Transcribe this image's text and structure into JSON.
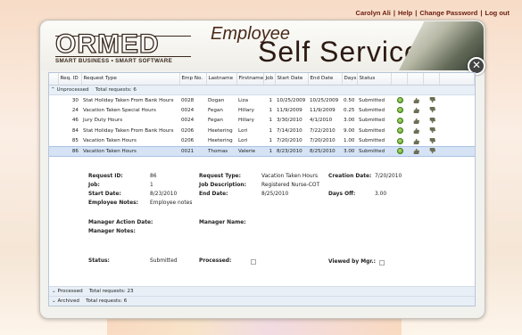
{
  "topnav": {
    "user": "Carolyn Ali",
    "help": "Help",
    "change_password": "Change Password",
    "logout": "Log out"
  },
  "header": {
    "logo": "ORMED",
    "tagline": "SMART BUSINESS • SMART SOFTWARE",
    "title_top": "Employee",
    "title_bottom": "Self Service"
  },
  "grid": {
    "columns": [
      "Req. ID",
      "Request Type",
      "Emp No.",
      "Lastname",
      "Firstname",
      "Job",
      "Start Date",
      "End Date",
      "Days",
      "Status"
    ],
    "unprocessed_label": "Unprocessed",
    "unprocessed_total": "Total requests: 6",
    "rows": [
      {
        "id": "30",
        "type": "Stat Holiday Taken From Bank Hours",
        "emp": "0028",
        "last": "Dogan",
        "first": "Liza",
        "job": "1",
        "start": "10/25/2009",
        "end": "10/25/2009",
        "days": "0.50",
        "status": "Submitted"
      },
      {
        "id": "24",
        "type": "Vacation Taken Special Hours",
        "emp": "0024",
        "last": "Fegan",
        "first": "Hillary",
        "job": "1",
        "start": "11/9/2009",
        "end": "11/9/2009",
        "days": "0.25",
        "status": "Submitted"
      },
      {
        "id": "46",
        "type": "Jury Duty Hours",
        "emp": "0024",
        "last": "Fegan",
        "first": "Hillary",
        "job": "1",
        "start": "3/30/2010",
        "end": "4/1/2010",
        "days": "3.00",
        "status": "Submitted"
      },
      {
        "id": "84",
        "type": "Stat Holiday Taken From Bank Hours",
        "emp": "0206",
        "last": "Heetering",
        "first": "Lori",
        "job": "1",
        "start": "7/14/2010",
        "end": "7/22/2010",
        "days": "9.00",
        "status": "Submitted"
      },
      {
        "id": "85",
        "type": "Vacation Taken Hours",
        "emp": "0206",
        "last": "Heetering",
        "first": "Lori",
        "job": "1",
        "start": "7/20/2010",
        "end": "7/20/2010",
        "days": "1.00",
        "status": "Submitted"
      },
      {
        "id": "86",
        "type": "Vacation Taken Hours",
        "emp": "0021",
        "last": "Thomas",
        "first": "Valerie",
        "job": "1",
        "start": "8/23/2010",
        "end": "8/25/2010",
        "days": "3.00",
        "status": "Submitted"
      }
    ]
  },
  "details": {
    "request_id_label": "Request ID:",
    "request_id": "86",
    "request_type_label": "Request Type:",
    "request_type": "Vacation Taken Hours",
    "creation_date_label": "Creation Date:",
    "creation_date": "7/20/2010",
    "job_label": "Job:",
    "job": "1",
    "job_desc_label": "Job Description:",
    "job_desc": "Registered Nurse-COT",
    "start_label": "Start Date:",
    "start": "8/23/2010",
    "end_label": "End Date:",
    "end": "8/25/2010",
    "days_off_label": "Days Off:",
    "days_off": "3.00",
    "emp_notes_label": "Employee Notes:",
    "emp_notes": "Employee notes",
    "mgr_action_label": "Manager Action Date:",
    "mgr_name_label": "Manager Name:",
    "mgr_notes_label": "Manager Notes:",
    "status_label": "Status:",
    "status": "Submitted",
    "processed_label": "Processed:",
    "viewed_label": "Viewed by Mgr.:"
  },
  "groups": {
    "processed_label": "Processed",
    "processed_total": "Total requests: 23",
    "archived_label": "Archived",
    "archived_total": "Total requests: 6"
  }
}
